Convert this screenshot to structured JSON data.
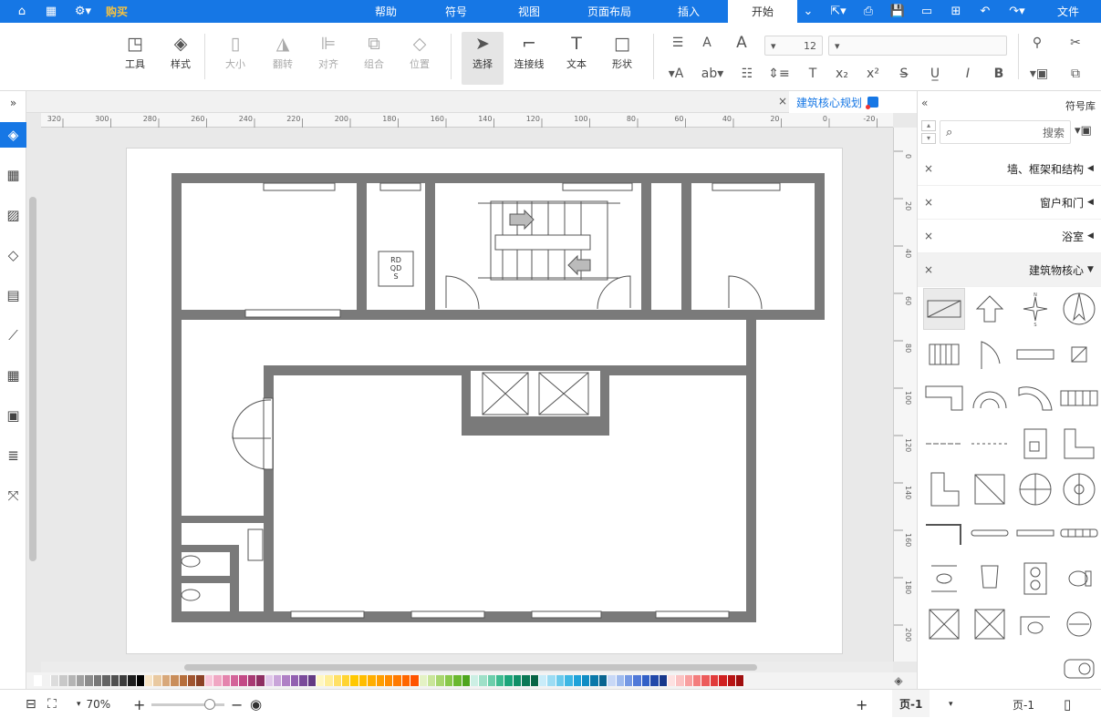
{
  "titlebar": {
    "tabs": [
      "文件",
      "开始",
      "插入",
      "页面布局",
      "视图",
      "符号",
      "帮助"
    ],
    "active_tab": "开始",
    "purchase_label": "购买",
    "accent": "#1677e5",
    "purchase_color": "#f5c242"
  },
  "ribbon": {
    "tools": {
      "shape": "形状",
      "text": "文本",
      "connector": "连接线",
      "select": "选择"
    },
    "arrange": {
      "position": "位置",
      "group": "组合",
      "align": "对齐",
      "flip": "翻转",
      "size": "大小"
    },
    "style": {
      "style": "样式",
      "tool": "工具"
    },
    "font_size": "12",
    "font_family": ""
  },
  "document": {
    "tab_title": "建筑核心规划",
    "close": "×"
  },
  "floorplan": {
    "elevator_label_1": "RD",
    "elevator_label_2": "QD",
    "elevator_label_3": "S"
  },
  "symbol_library": {
    "title": "符号库",
    "search_placeholder": "搜索",
    "categories": [
      {
        "name": "墙、框架和结构",
        "expanded": false
      },
      {
        "name": "窗户和门",
        "expanded": false
      },
      {
        "name": "浴室",
        "expanded": false
      },
      {
        "name": "建筑物核心",
        "expanded": true
      }
    ]
  },
  "rulers": {
    "h_ticks": [
      "320",
      "300",
      "280",
      "260",
      "240",
      "220",
      "200",
      "180",
      "160",
      "140",
      "120",
      "100",
      "80",
      "60",
      "40",
      "20",
      "0",
      "-20"
    ],
    "v_ticks": [
      "0",
      "20",
      "40",
      "60",
      "80",
      "100",
      "120",
      "140",
      "160",
      "180",
      "200"
    ]
  },
  "statusbar": {
    "page_name": "页-1",
    "page_tab": "页-1",
    "zoom": "70%",
    "add": "+"
  },
  "palette": [
    "#ffffff",
    "#f2f2f2",
    "#dcdcdc",
    "#c8c8c8",
    "#b4b4b4",
    "#a0a0a0",
    "#8c8c8c",
    "#787878",
    "#646464",
    "#505050",
    "#3c3c3c",
    "#1e1e1e",
    "#000000",
    "#f7e4c6",
    "#e9c9a0",
    "#d8a87a",
    "#c98d5a",
    "#b66e3b",
    "#a05530",
    "#8b4226",
    "#f8c6d9",
    "#f0a7c3",
    "#e484ad",
    "#d36499",
    "#c34a86",
    "#a83a73",
    "#8e2f62",
    "#e1c8ea",
    "#c9a5d9",
    "#af80c5",
    "#9260b0",
    "#7a4a9a",
    "#633a83",
    "#fff7c2",
    "#ffee99",
    "#ffe066",
    "#ffd433",
    "#ffc800",
    "#ffbd00",
    "#ffae00",
    "#ff9e00",
    "#ff8c00",
    "#ff7a00",
    "#ff6600",
    "#ff5200",
    "#e4f2c5",
    "#c9e59a",
    "#a8d66e",
    "#88c84a",
    "#6ab82f",
    "#4ea51d",
    "#ccefe4",
    "#9fe0c8",
    "#6cceab",
    "#3dbb90",
    "#1ba57a",
    "#0f8f67",
    "#0a7855",
    "#086445",
    "#c9ecf9",
    "#9cdcf3",
    "#6bcaec",
    "#3eb7e4",
    "#1ea2d9",
    "#0f8cc4",
    "#0a78a9",
    "#0a6590",
    "#c8d8f6",
    "#9fbbee",
    "#7599e4",
    "#5079d8",
    "#3260c7",
    "#2148a9",
    "#16378b",
    "#fde1e1",
    "#fbc3c3",
    "#f8a0a0",
    "#f37d7d",
    "#ec5a5a",
    "#e13b3b",
    "#d02020",
    "#b81414",
    "#9f0e0e"
  ]
}
